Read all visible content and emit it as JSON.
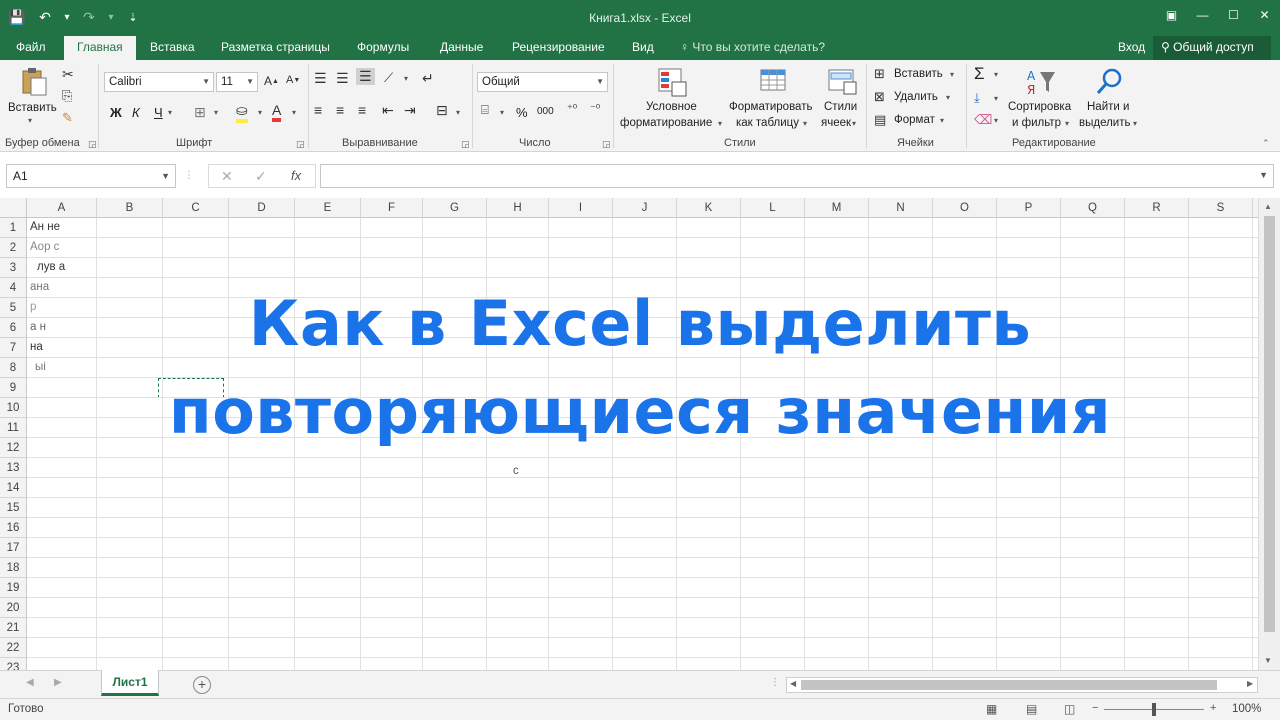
{
  "window": {
    "title": "Книга1.xlsx - Excel",
    "controls": [
      "▣",
      "—",
      "☐",
      "✕"
    ]
  },
  "qat": {
    "save": "💾",
    "undo": "↶",
    "undo_menu": "▾",
    "redo": "↷",
    "redo_menu": "▾",
    "customize": "⇣"
  },
  "tabs": {
    "file": "Файл",
    "home": "Главная",
    "insert": "Вставка",
    "page_layout": "Разметка страницы",
    "formulas": "Формулы",
    "data": "Данные",
    "review": "Рецензирование",
    "view": "Вид",
    "tell_me": "Что вы хотите сделать?",
    "login": "Вход",
    "share": "Общий доступ"
  },
  "ribbon": {
    "clipboard": {
      "label": "Буфер обмена",
      "paste": "Вставить"
    },
    "font": {
      "label": "Шрифт",
      "font_name": "Calibri",
      "font_size": "11",
      "bold": "Ж",
      "italic": "К",
      "underline": "Ч"
    },
    "alignment": {
      "label": "Выравнивание"
    },
    "number": {
      "label": "Число",
      "format": "Общий",
      "percent": "%",
      "thousands": "000"
    },
    "styles": {
      "label": "Стили",
      "conditional": [
        "Условное",
        "форматирование"
      ],
      "format_table": [
        "Форматировать",
        "как таблицу"
      ],
      "cell_styles": [
        "Стили",
        "ячеек"
      ]
    },
    "cells": {
      "label": "Ячейки",
      "insert": "Вставить",
      "delete": "Удалить",
      "format": "Формат"
    },
    "editing": {
      "label": "Редактирование",
      "sort": [
        "Сортировка",
        "и фильтр"
      ],
      "find": [
        "Найти и",
        "выделить"
      ],
      "sigma": "Σ"
    }
  },
  "formula_bar": {
    "name_box": "A1",
    "cancel": "✕",
    "enter": "✓",
    "fx": "fx",
    "value": ""
  },
  "grid": {
    "columns": [
      "A",
      "B",
      "C",
      "D",
      "E",
      "F",
      "G",
      "H",
      "I",
      "J",
      "K",
      "L",
      "M",
      "N",
      "O",
      "P",
      "Q",
      "R",
      "S"
    ],
    "rows": [
      "1",
      "2",
      "3",
      "4",
      "5",
      "6",
      "7",
      "8",
      "9",
      "10",
      "11",
      "12",
      "13",
      "14",
      "15",
      "16",
      "17",
      "18",
      "19",
      "20",
      "21",
      "22",
      "23"
    ],
    "cell_fragments": [
      "Ан не",
      "Аор   с",
      "лув    а",
      "  ана",
      "  р",
      "      а   н",
      "     на",
      "ыі",
      "с"
    ]
  },
  "overlay": {
    "line1": "Как в Excel выделить",
    "line2": "повторяющиеся значения"
  },
  "sheets": {
    "active": "Лист1",
    "add": "+"
  },
  "status": {
    "ready": "Готово",
    "zoom": "100%"
  },
  "colors": {
    "excel_green": "#217346",
    "overlay_blue": "#1a73e8"
  }
}
